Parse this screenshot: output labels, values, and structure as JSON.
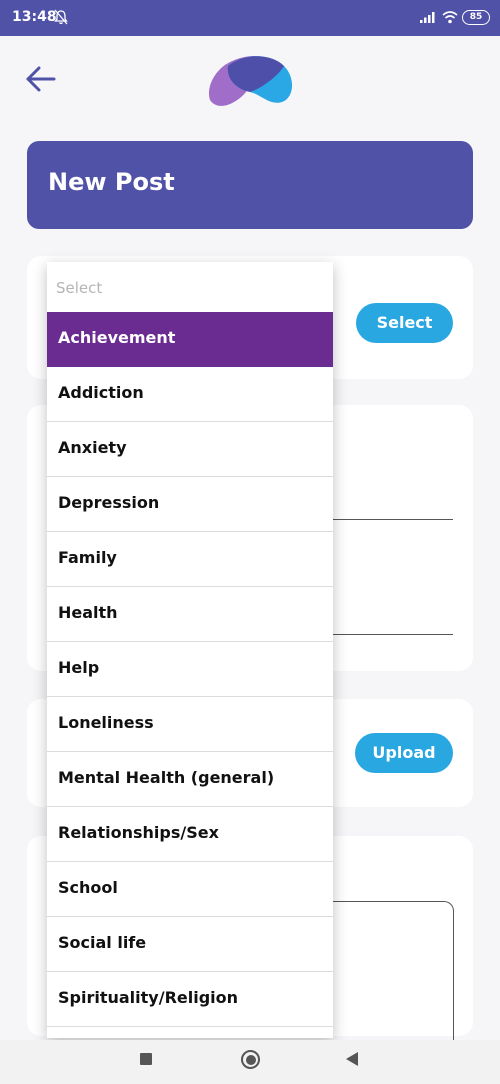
{
  "status_bar": {
    "time": "13:48",
    "battery": "85"
  },
  "header": {
    "title": "New Post"
  },
  "buttons": {
    "select": "Select",
    "upload": "Upload"
  },
  "dropdown": {
    "placeholder": "Select",
    "selected": "Achievement",
    "options": [
      "Achievement",
      "Addiction",
      "Anxiety",
      "Depression",
      "Family",
      "Health",
      "Help",
      "Loneliness",
      "Mental Health (general)",
      "Relationships/Sex",
      "School",
      "Social life",
      "Spirituality/Religion"
    ]
  },
  "colors": {
    "primary": "#5052a8",
    "accent": "#29a7e1",
    "selected": "#6a2c91"
  },
  "icons": {
    "back": "arrow-left-icon",
    "logo": "app-logo",
    "mute": "bell-off-icon",
    "signal": "signal-icon",
    "wifi": "wifi-icon"
  }
}
